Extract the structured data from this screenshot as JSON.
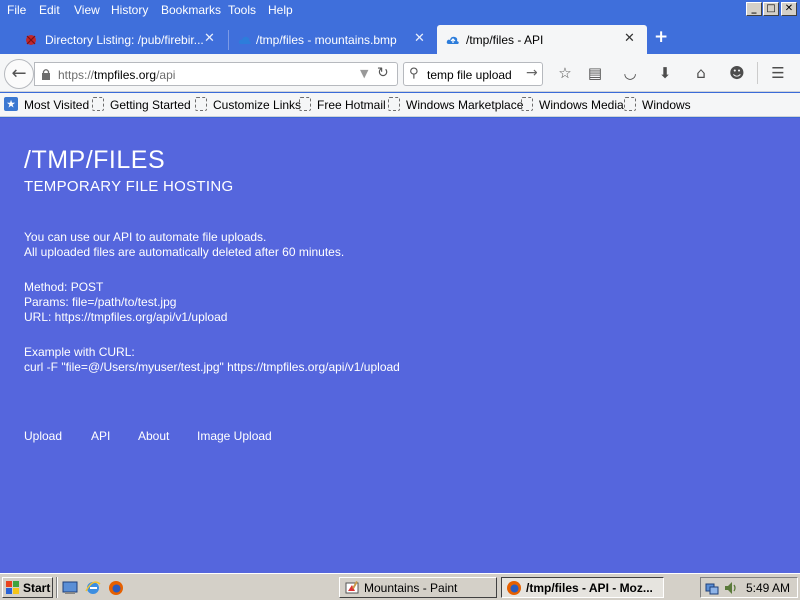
{
  "menubar": {
    "items": [
      "File",
      "Edit",
      "View",
      "History",
      "Bookmarks",
      "Tools",
      "Help"
    ],
    "window_controls": [
      "_",
      "□",
      "✕"
    ]
  },
  "tabs": [
    {
      "label": "Directory Listing: /pub/firebir...",
      "icon": "firebird-icon",
      "active": false
    },
    {
      "label": "/tmp/files - mountains.bmp",
      "icon": "cloud-icon",
      "active": false
    },
    {
      "label": "/tmp/files - API",
      "icon": "cloud-icon",
      "active": true
    }
  ],
  "tab_close_glyph": "✕",
  "new_tab_glyph": "+",
  "navbar": {
    "url_prefix": "https://",
    "url_host": "tmpfiles.org",
    "url_path": "/api",
    "search_value": "temp file upload"
  },
  "bookmarks": [
    "Most Visited",
    "Getting Started",
    "Customize Links",
    "Free Hotmail",
    "Windows Marketplace",
    "Windows Media",
    "Windows"
  ],
  "page": {
    "title": "/TMP/FILES",
    "subtitle": "TEMPORARY FILE HOSTING",
    "intro_1": "You can use our API to automate file uploads.",
    "intro_2": "All uploaded files are automatically deleted after 60 minutes.",
    "method": "Method: POST",
    "params": "Params: file=/path/to/test.jpg",
    "url": "URL: https://tmpfiles.org/api/v1/upload",
    "example_heading": "Example with CURL:",
    "example_cmd": "curl -F \"file=@/Users/myuser/test.jpg\" https://tmpfiles.org/api/v1/upload",
    "footer_links": [
      "Upload",
      "API",
      "About",
      "Image Upload"
    ]
  },
  "taskbar": {
    "start_label": "Start",
    "tasks": [
      {
        "label": "Mountains - Paint",
        "icon": "paint-icon",
        "active": false
      },
      {
        "label": "/tmp/files - API - Moz...",
        "icon": "firefox-icon",
        "active": true
      }
    ],
    "clock": "5:49 AM"
  },
  "colors": {
    "page_bg": "#5566dd",
    "chrome_bg": "#3f6fdb",
    "toolbar_bg": "#f5f6f7"
  }
}
